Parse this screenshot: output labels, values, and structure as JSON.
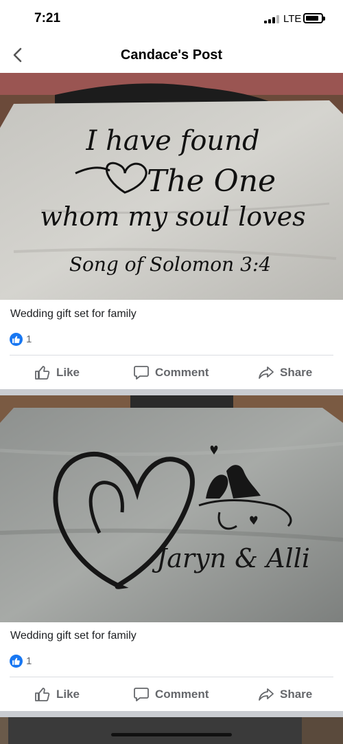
{
  "status_bar": {
    "time": "7:21",
    "carrier": "LTE"
  },
  "nav": {
    "title": "Candace's Post"
  },
  "posts": [
    {
      "image_text": {
        "line1": "I have found",
        "line2": "The One",
        "line3": "whom my soul loves",
        "line4": "Song of Solomon 3:4"
      },
      "caption": "Wedding gift set for family",
      "reaction_count": "1",
      "actions": {
        "like": "Like",
        "comment": "Comment",
        "share": "Share"
      }
    },
    {
      "image_text": {
        "names": "Jaryn & Alli"
      },
      "caption": "Wedding gift set for family",
      "reaction_count": "1",
      "actions": {
        "like": "Like",
        "comment": "Comment",
        "share": "Share"
      }
    }
  ],
  "icons": {
    "back": "chevron-left-icon",
    "like": "thumbs-up-icon",
    "comment": "speech-bubble-icon",
    "share": "share-arrow-icon"
  },
  "colors": {
    "like_badge": "#1877f2",
    "action_text": "#65676b",
    "separator": "#c9ccd1"
  }
}
